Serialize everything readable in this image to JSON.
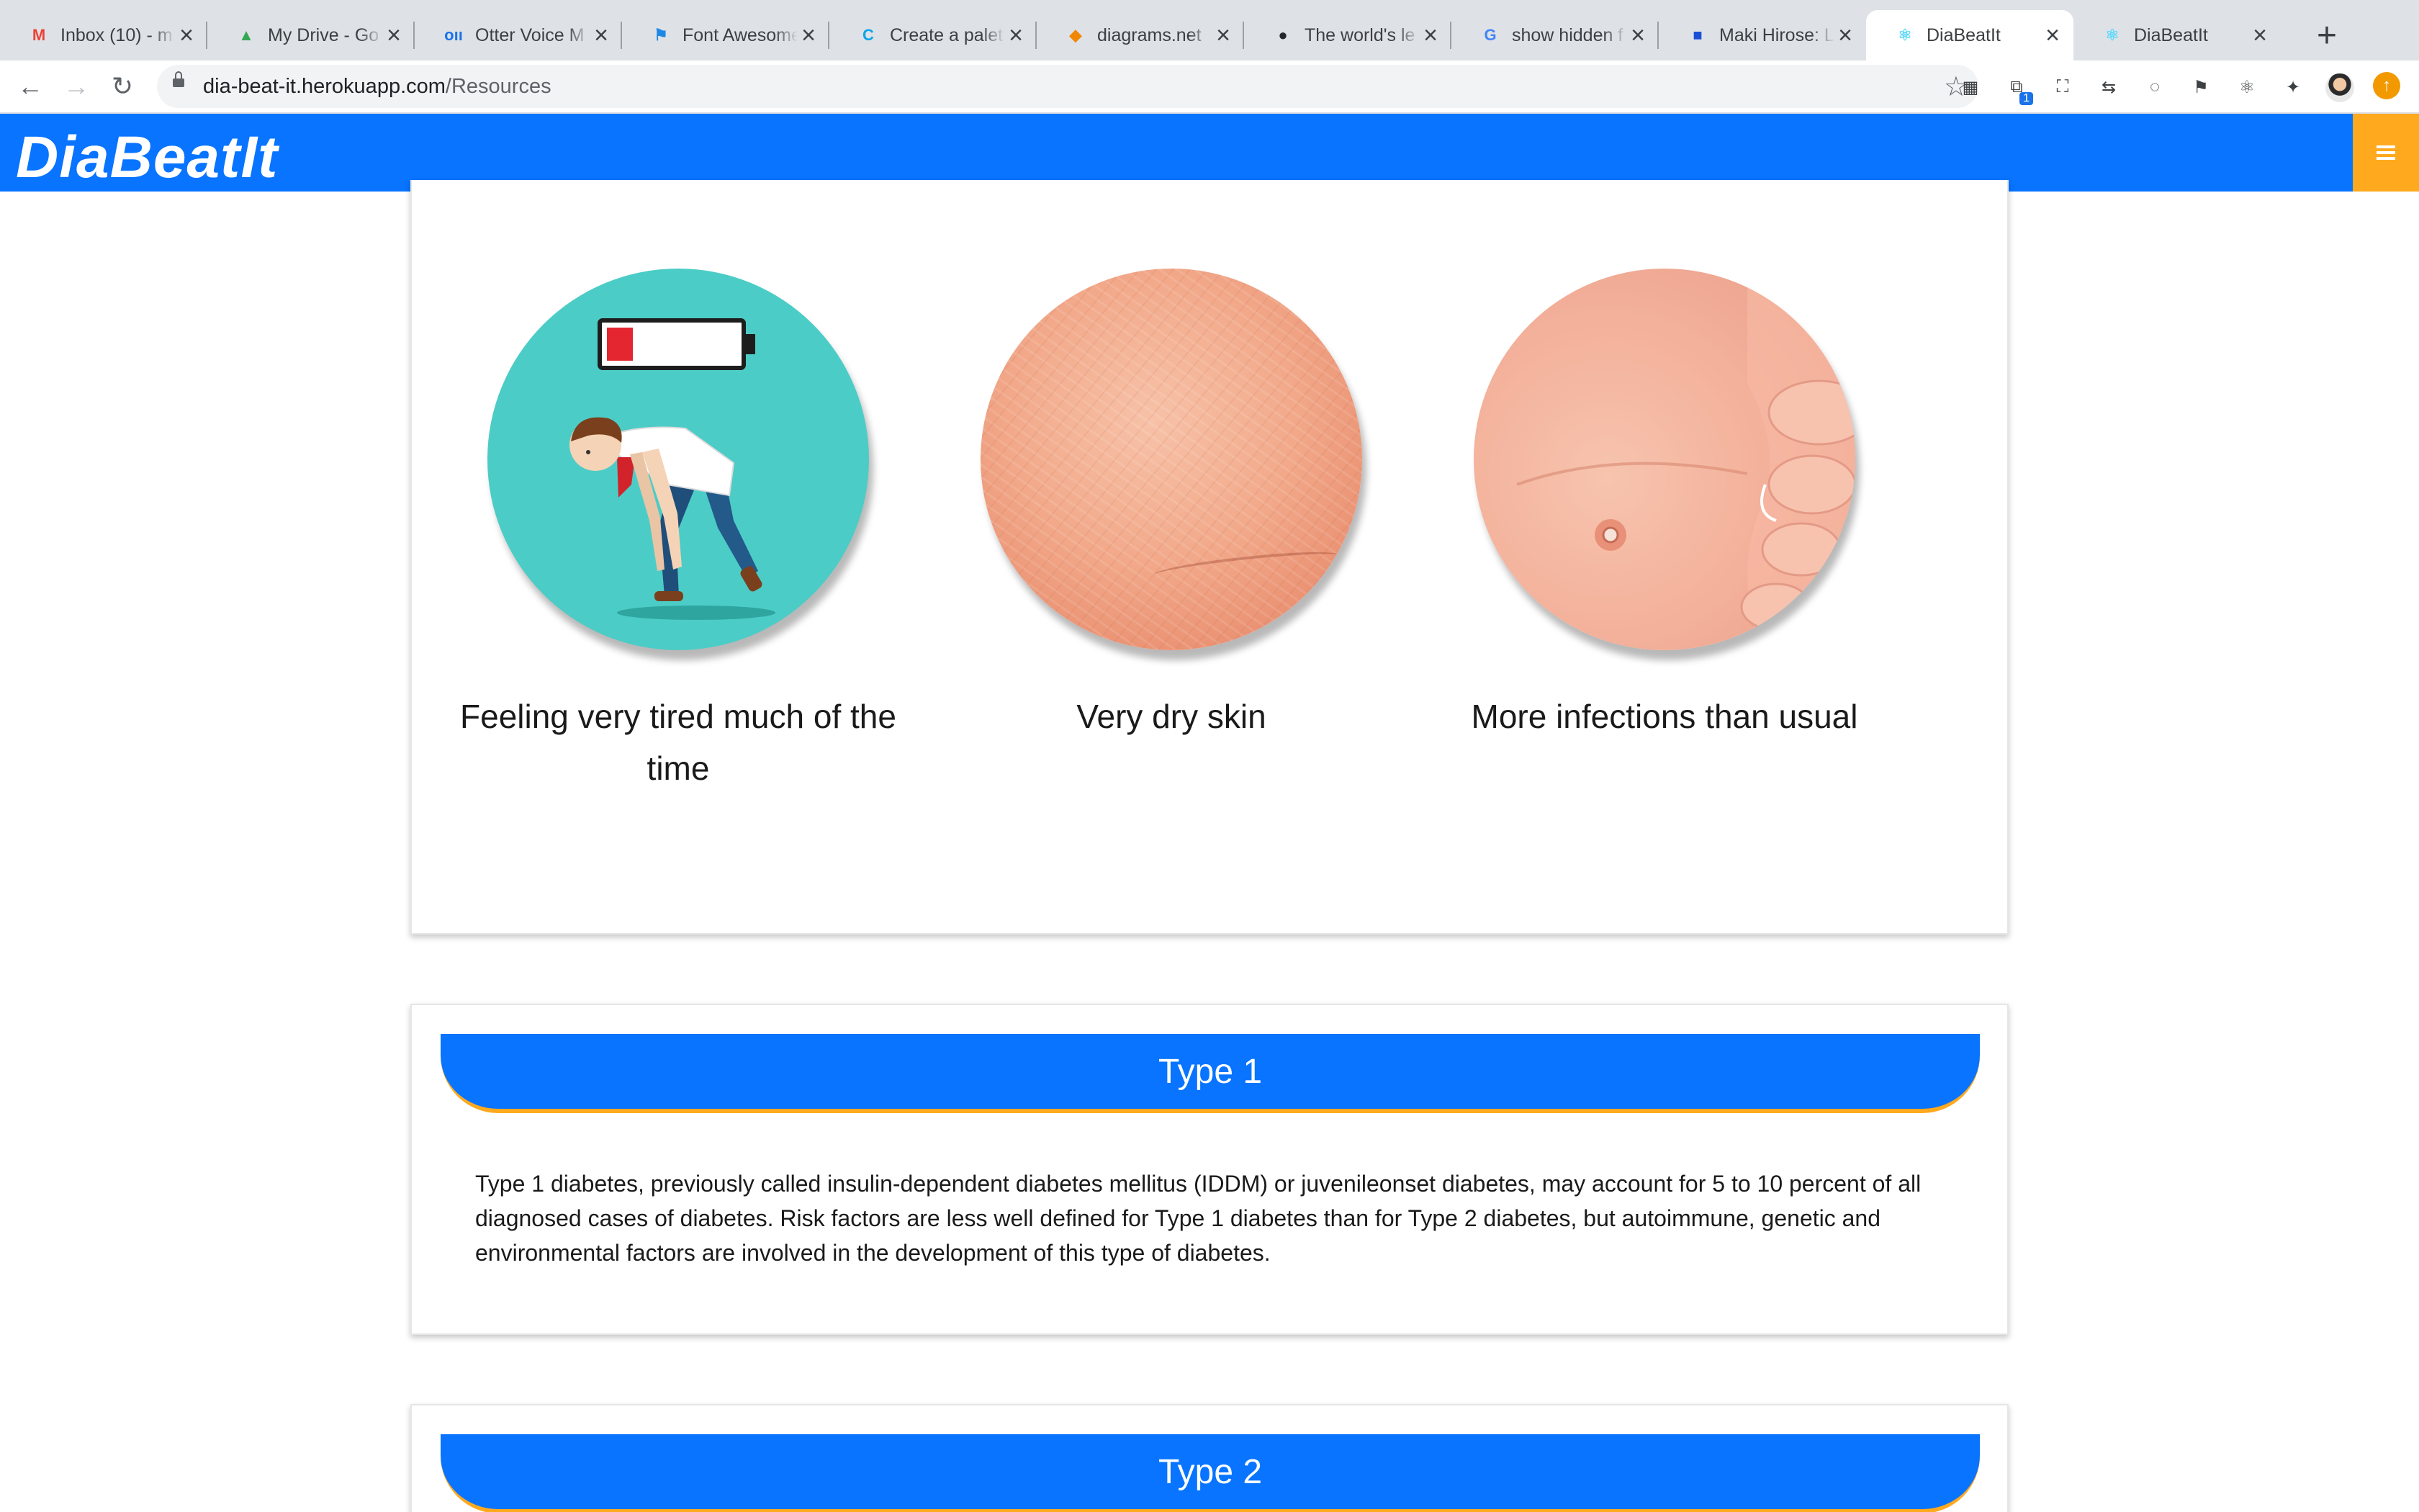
{
  "browser": {
    "tabs": [
      {
        "title": "Inbox (10) - m",
        "icon": "gmail-icon",
        "icon_glyph": "M",
        "icon_color": "#ea4335"
      },
      {
        "title": "My Drive - Go",
        "icon": "google-drive-icon",
        "icon_glyph": "▲",
        "icon_color": "#34a853"
      },
      {
        "title": "Otter Voice M",
        "icon": "otter-icon",
        "icon_glyph": "oıı",
        "icon_color": "#1a73e8"
      },
      {
        "title": "Font Awesome",
        "icon": "font-awesome-flag-icon",
        "icon_glyph": "⚑",
        "icon_color": "#1c88e5"
      },
      {
        "title": "Create a palet",
        "icon": "coolors-icon",
        "icon_glyph": "C",
        "icon_color": "#0ba5e9"
      },
      {
        "title": "diagrams.net",
        "icon": "diagrams-icon",
        "icon_glyph": "◆",
        "icon_color": "#f08705"
      },
      {
        "title": "The world's le",
        "icon": "github-icon",
        "icon_glyph": "●",
        "icon_color": "#24292e"
      },
      {
        "title": "show hidden f",
        "icon": "google-icon",
        "icon_glyph": "G",
        "icon_color": "#4285f4"
      },
      {
        "title": "Maki Hirose: L",
        "icon": "square-icon",
        "icon_glyph": "■",
        "icon_color": "#1a4fd6"
      },
      {
        "title": "DiaBeatIt",
        "icon": "react-icon",
        "icon_glyph": "⚛",
        "icon_color": "#61dafb"
      },
      {
        "title": "DiaBeatIt",
        "icon": "react-icon",
        "icon_glyph": "⚛",
        "icon_color": "#61dafb"
      }
    ],
    "active_tab": 9,
    "new_tab_glyph": "+",
    "close_glyph": "×",
    "url_host": "dia-beat-it.herokuapp.com",
    "url_path": "/Resources",
    "back_glyph": "←",
    "forward_glyph": "→",
    "reload_glyph": "↻",
    "star_glyph": "☆",
    "extensions": [
      {
        "name": "extension-grid-icon",
        "glyph": "▦"
      },
      {
        "name": "extension-share-icon",
        "glyph": "⧉",
        "badge": "1"
      },
      {
        "name": "screenshot-icon",
        "glyph": "⛶"
      },
      {
        "name": "extension-arrows-icon",
        "glyph": "⇆"
      },
      {
        "name": "extension-circle-icon",
        "glyph": "◌"
      },
      {
        "name": "extension-flag-icon",
        "glyph": "⚑"
      },
      {
        "name": "extension-react-icon",
        "glyph": "⚛"
      },
      {
        "name": "extensions-puzzle-icon",
        "glyph": "✦"
      }
    ],
    "update_glyph": "↑"
  },
  "app": {
    "brand": "DiaBeatIt",
    "brand_color": "#0874ff",
    "accent_color": "#ffa91f"
  },
  "symptoms": [
    {
      "label": "Feeling very tired much of the time",
      "image": "tired-man-illustration"
    },
    {
      "label": "Very dry skin",
      "image": "dry-skin-photo"
    },
    {
      "label": "More infections than usual",
      "image": "foot-infection-photo"
    }
  ],
  "types": [
    {
      "title": "Type 1",
      "body": "Type 1 diabetes, previously called insulin-dependent diabetes mellitus (IDDM) or juvenileonset diabetes, may account for 5 to 10 percent of all diagnosed cases of diabetes. Risk factors are less well defined for Type 1 diabetes than for Type 2 diabetes, but autoimmune, genetic and environmental factors are involved in the development of this type of diabetes."
    },
    {
      "title": "Type 2"
    }
  ]
}
